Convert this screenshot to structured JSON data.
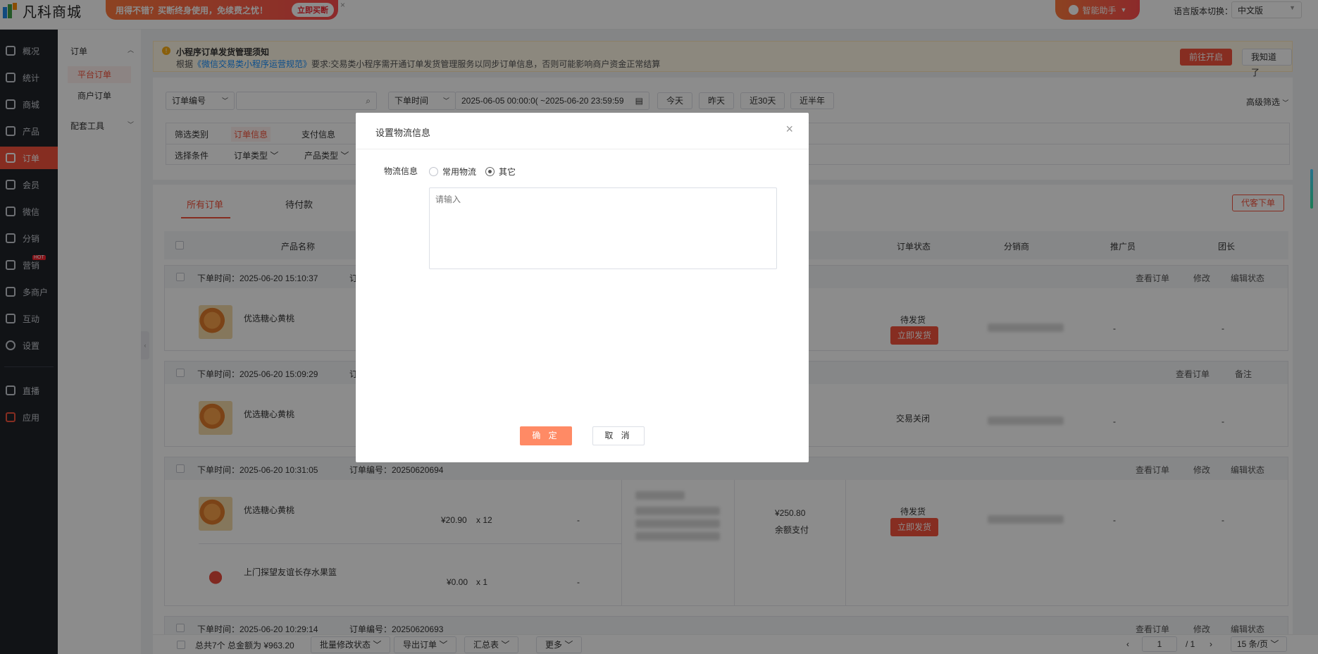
{
  "topbar": {
    "logo_text": "凡科商城",
    "promo_text": "用得不错？买断终身使用，免续费之忧！",
    "promo_button": "立即买断",
    "promo_close": "×",
    "assistant": "智能助手",
    "lang_label": "语言版本切换：",
    "lang_value": "中文版"
  },
  "sidebar": {
    "items": [
      "概况",
      "统计",
      "商城",
      "产品",
      "订单",
      "会员",
      "微信",
      "分销",
      "营销",
      "多商户",
      "互动",
      "设置",
      "直播",
      "应用"
    ],
    "hot_badge": "HOT"
  },
  "subnav": {
    "group_order": "订单",
    "platform_orders": "平台订单",
    "merchant_orders": "商户订单",
    "tools": "配套工具"
  },
  "notice": {
    "title": "小程序订单发货管理须知",
    "text_prefix": "根据",
    "link": "《微信交易类小程序运营规范》",
    "text_suffix": "要求:交易类小程序需开通订单发货管理服务以同步订单信息，否则可能影响商户资金正常结算",
    "go_button": "前往开启",
    "know_button": "我知道了"
  },
  "filters": {
    "order_no_select": "订单编号",
    "time_select": "下单时间",
    "date_range": "2025-06-05 00:00:0( ~2025-06-20 23:59:59",
    "today": "今天",
    "yesterday": "昨天",
    "last30": "近30天",
    "half_year": "近半年",
    "advanced": "高级筛选",
    "row1_label": "筛选类别",
    "row1_active": "订单信息",
    "row1_other": "支付信息",
    "row2_label": "选择条件",
    "row2_order_type": "订单类型",
    "row2_product_type": "产品类型"
  },
  "orders": {
    "tab_all": "所有订单",
    "tab_pending": "待付款",
    "place_order": "代客下单",
    "headers": {
      "product": "产品名称",
      "status": "订单状态",
      "distributor": "分销商",
      "promoter": "推广员",
      "leader": "团长"
    },
    "list": [
      {
        "time": "下单时间：2025-06-20 15:10:37",
        "no_label": "订",
        "actions": [
          "查看订单",
          "修改",
          "编辑状态"
        ],
        "product": "优选糖心黄桃",
        "status": "待发货",
        "status_button": "立即发货",
        "promoter": "-",
        "leader": "-"
      },
      {
        "time": "下单时间：2025-06-20 15:09:29",
        "no_label": "订",
        "actions": [
          "查看订单",
          "备注"
        ],
        "product": "优选糖心黄桃",
        "status": "交易关闭",
        "promoter": "-",
        "leader": "-"
      },
      {
        "time": "下单时间：2025-06-20 10:31:05",
        "no_label": "订单编号：20250620694",
        "actions": [
          "查看订单",
          "修改",
          "编辑状态"
        ],
        "product": "优选糖心黄桃",
        "price": "¥20.90",
        "qty": "x 12",
        "product2": "上门探望友谊长存水果篮",
        "price2": "¥0.00",
        "qty2": "x 1",
        "dash": "-",
        "total": "¥250.80",
        "pay_method": "余额支付",
        "status": "待发货",
        "status_button": "立即发货",
        "promoter": "-",
        "leader": "-"
      },
      {
        "time": "下单时间：2025-06-20 10:29:14",
        "no_label": "订单编号：20250620693",
        "actions": [
          "查看订单",
          "修改",
          "编辑状态"
        ]
      }
    ]
  },
  "footer": {
    "summary": "总共7个  总金额为 ¥963.20",
    "batch": "批量修改状态",
    "export": "导出订单",
    "summary_table": "汇总表",
    "more": "更多",
    "page_current": "1",
    "page_total": "/ 1",
    "page_size": "15 条/页"
  },
  "modal": {
    "title": "设置物流信息",
    "close": "×",
    "field_label": "物流信息",
    "option_common": "常用物流",
    "option_other": "其它",
    "selected_option": "其它",
    "placeholder": "请输入",
    "confirm": "确 定",
    "cancel": "取 消"
  }
}
